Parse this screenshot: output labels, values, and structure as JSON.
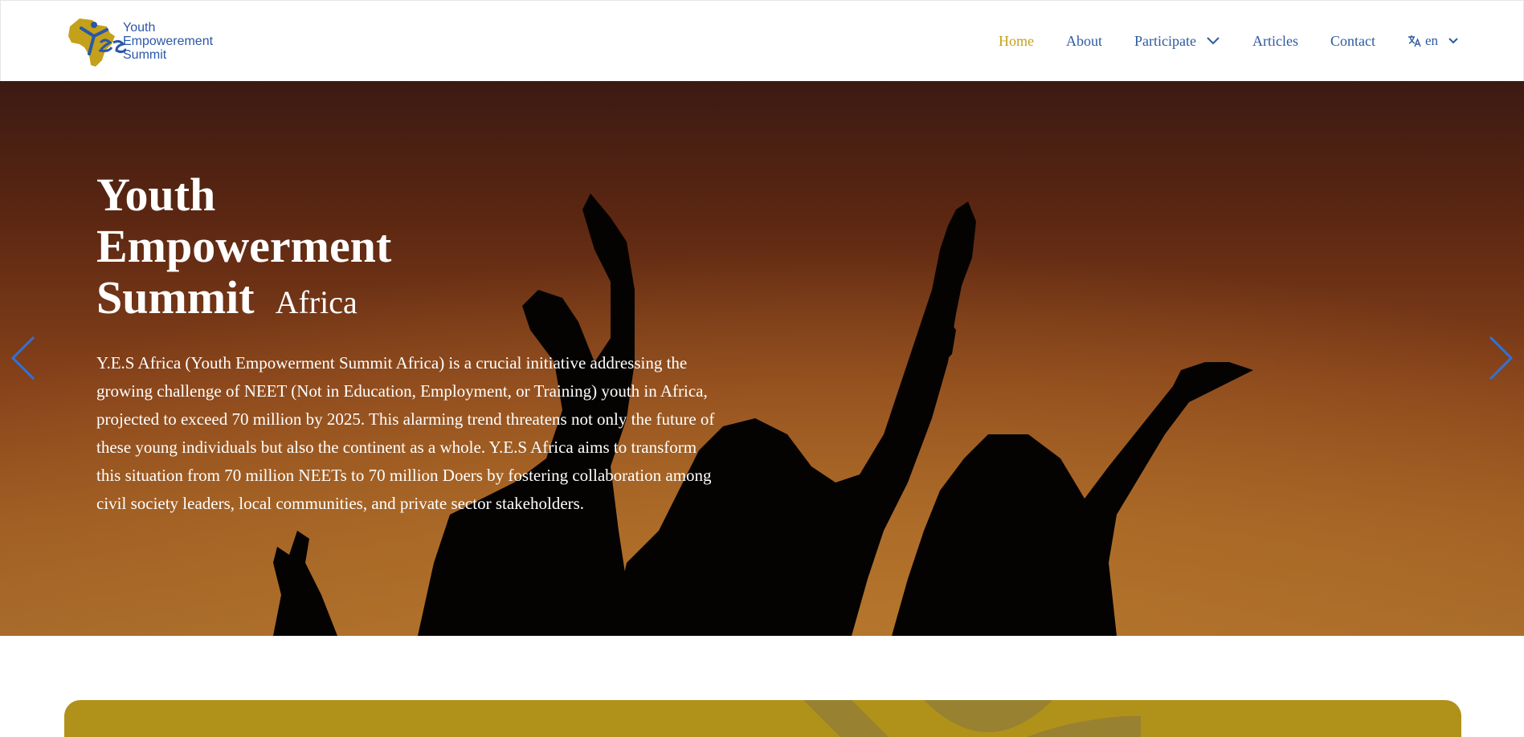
{
  "header": {
    "logo": {
      "line1": "Youth",
      "line2": "Empowerement",
      "line3": "Summit",
      "mark_text": "YES"
    },
    "nav": [
      {
        "label": "Home",
        "active": true
      },
      {
        "label": "About",
        "active": false
      },
      {
        "label": "Participate",
        "active": false,
        "has_dropdown": true
      },
      {
        "label": "Articles",
        "active": false
      },
      {
        "label": "Contact",
        "active": false
      }
    ],
    "language": {
      "label": "en",
      "icon": "translate-icon"
    }
  },
  "hero": {
    "title_line1": "Youth",
    "title_line2": "Empowerment",
    "title_line3": "Summit",
    "title_suffix": "Africa",
    "description": "Y.E.S Africa (Youth Empowerment Summit Africa) is a crucial initiative addressing the growing challenge of NEET (Not in Education, Employment, or Training) youth in Africa, projected to exceed 70 million by 2025. This alarming trend threatens not only the future of these young individuals but also the continent as a whole. Y.E.S Africa aims to transform this situation from 70 million NEETs to 70 million Doers by fostering collaboration among civil society leaders, local communities, and private sector stakeholders.",
    "prev_icon": "chevron-left-icon",
    "next_icon": "chevron-right-icon"
  },
  "colors": {
    "brand_blue": "#2d5aa0",
    "brand_gold": "#c4a11a",
    "card_gold": "#b0921a"
  }
}
